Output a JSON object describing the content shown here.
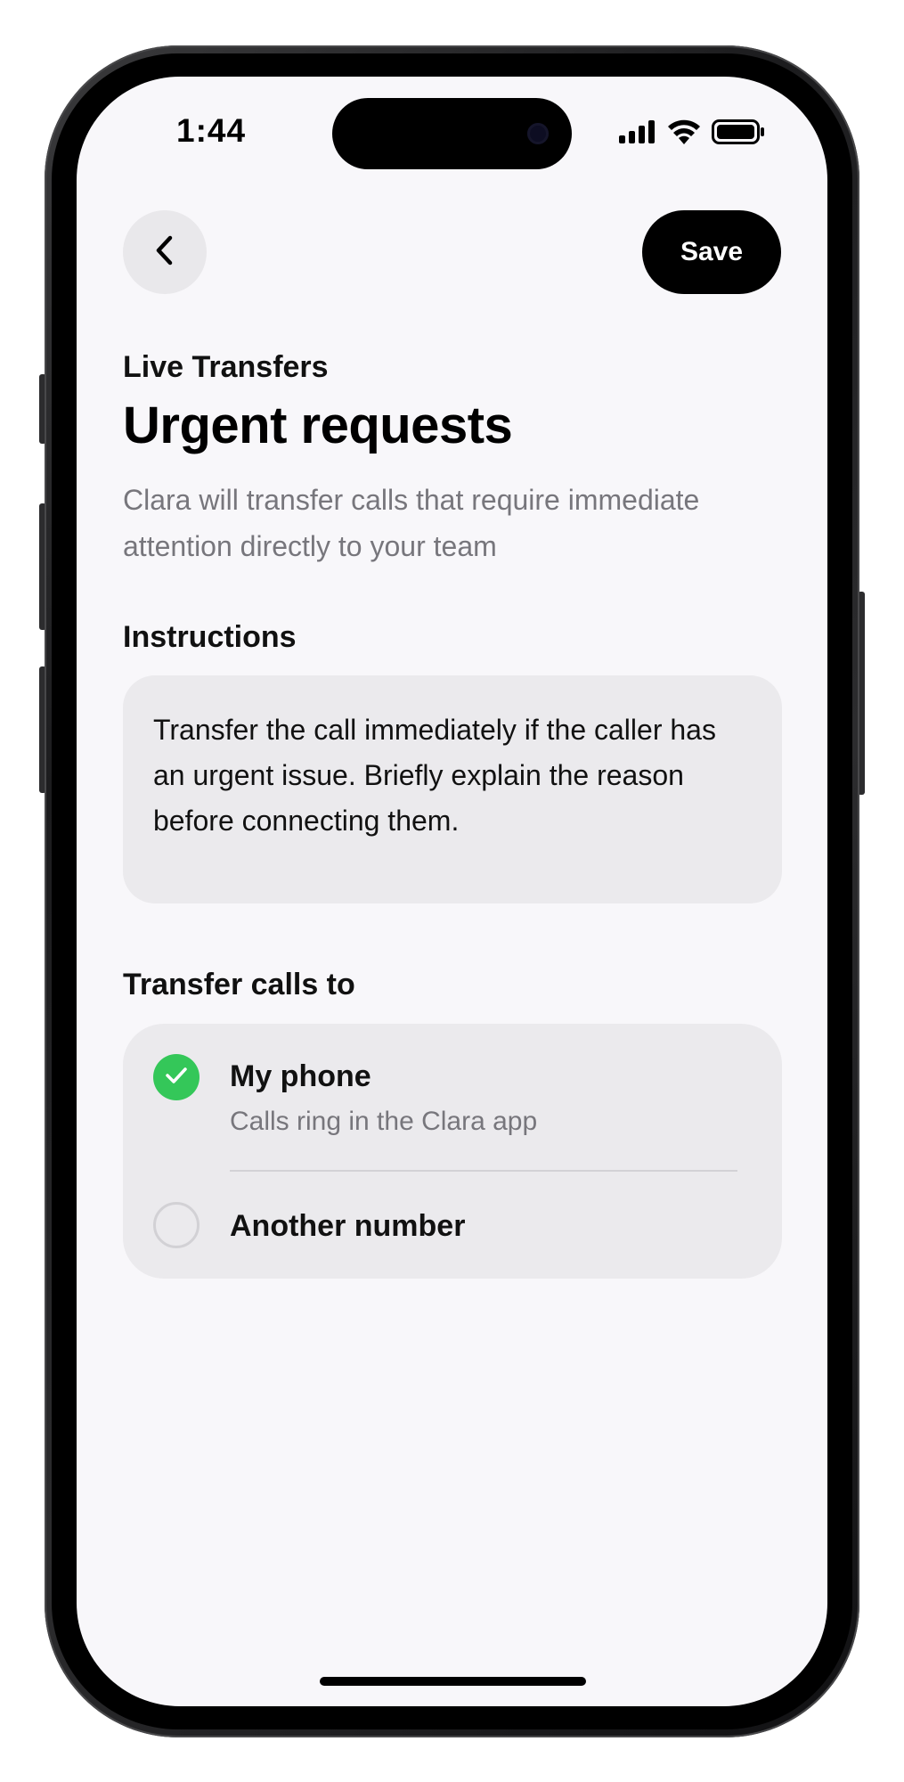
{
  "status_bar": {
    "time": "1:44",
    "icons": [
      "cellular-signal-icon",
      "wifi-icon",
      "battery-icon"
    ]
  },
  "nav": {
    "back_icon": "chevron-left-icon",
    "save_label": "Save"
  },
  "header": {
    "eyebrow": "Live Transfers",
    "title": "Urgent requests",
    "description": "Clara will transfer calls that require immediate attention directly to your team"
  },
  "instructions": {
    "heading": "Instructions",
    "text": "Transfer the call immediately if the caller has an urgent issue. Briefly explain the reason before connecting them."
  },
  "transfer": {
    "heading": "Transfer calls to",
    "options": [
      {
        "title": "My phone",
        "subtitle": "Calls ring in the Clara app",
        "selected": true
      },
      {
        "title": "Another number",
        "subtitle": "",
        "selected": false
      }
    ]
  },
  "colors": {
    "accent_green": "#34c759",
    "primary_black": "#000000",
    "card_bg": "#ebeaed",
    "screen_bg": "#f8f7fa",
    "secondary_text": "#77767c"
  }
}
